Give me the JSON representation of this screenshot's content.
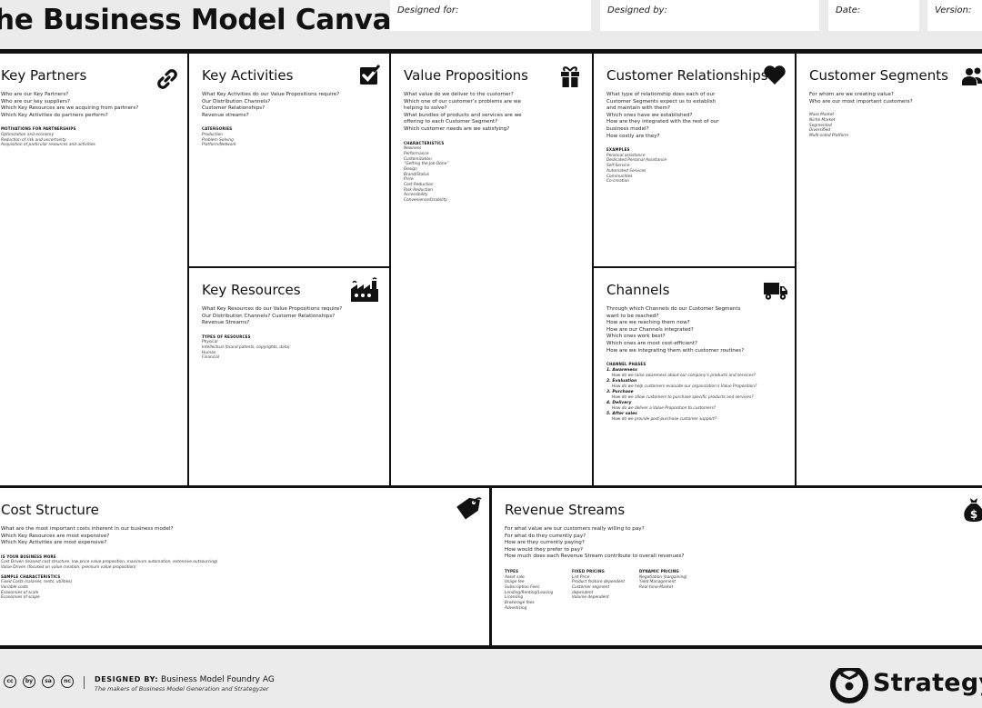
{
  "header": {
    "title": "he Business Model Canvas",
    "designed_for": "Designed for:",
    "designed_by": "Designed by:",
    "date": "Date:",
    "version": "Version:"
  },
  "key_partners": {
    "title": "Key Partners",
    "icon": "link-icon",
    "questions": [
      "Who are our Key Partners?",
      "Who are our key suppliers?",
      "Which Key Resources are we acquiring from partners?",
      "Which Key Activities do partners perform?"
    ],
    "subhead": "MOTIVATIONS FOR PARTNERSHIPS",
    "items": [
      "Optimization and economy",
      "Reduction of risk and uncertainty",
      "Acquisition of particular resources and activities"
    ]
  },
  "key_activities": {
    "title": "Key Activities",
    "icon": "checkbox-icon",
    "questions": [
      "What Key Activities do our Value Propositions require?",
      "Our Distribution Channels?",
      "Customer Relationships?",
      "Revenue streams?"
    ],
    "subhead": "CATERGORIES",
    "items": [
      "Production",
      "Problem Solving",
      "Platform/Network"
    ]
  },
  "key_resources": {
    "title": "Key Resources",
    "icon": "factory-icon",
    "questions": [
      "What Key Resources do our Value Propositions require?",
      "Our Distribution Channels? Customer Relationships?",
      "Revenue Streams?"
    ],
    "subhead": "TYPES OF RESOURCES",
    "items": [
      "Physical",
      "Intellectual (brand patents, copyrights, data)",
      "Human",
      "Financial"
    ]
  },
  "value_propositions": {
    "title": "Value Propositions",
    "icon": "gift-icon",
    "questions": [
      "What value do we deliver to the customer?",
      "Which one of our customer’s problems are we",
      "helping to solve?",
      "What bundles of products and services are we",
      "offering to each Customer Segment?",
      "Which customer needs are we satisfying?"
    ],
    "subhead": "CHARACTERISTICS",
    "items": [
      "Newness",
      "Performance",
      "Customization",
      "“Getting the Job Done”",
      "Design",
      "Brand/Status",
      "Price",
      "Cost Reduction",
      "Risk Reduction",
      "Accessibility",
      "Convenience/Usability"
    ]
  },
  "customer_relationships": {
    "title": "Customer Relationships",
    "icon": "heart-icon",
    "questions": [
      "What type of relationship does each of our",
      "Customer Segments expect us to establish",
      "and maintain with them?",
      "Which ones have we established?",
      "How are they integrated with the rest of our",
      "business model?",
      "How costly are they?"
    ],
    "subhead": "EXAMPLES",
    "items": [
      "Personal assistance",
      "Dedicated Personal Assistance",
      "Self-Service",
      "Automated Services",
      "Communities",
      "Co-creation"
    ]
  },
  "channels": {
    "title": "Channels",
    "icon": "truck-icon",
    "questions": [
      "Through which Channels do our Customer Segments",
      "want to be reached?",
      "How are we reaching them now?",
      "How are our Channels integrated?",
      "Which ones work best?",
      "Which ones are most cost-efficient?",
      "How are we integrating them with customer routines?"
    ],
    "subhead": "CHANNEL PHASES",
    "phases": [
      {
        "name": "1. Awareness",
        "desc": "How do we raise awareness about our company’s products and services?"
      },
      {
        "name": "2. Evaluation",
        "desc": "How do we help customers evaluate our organization’s Value Proposition?"
      },
      {
        "name": "3. Purchase",
        "desc": "How do we allow customers to purchase specific products and services?"
      },
      {
        "name": "4. Delivery",
        "desc": "How do we deliver a Value Proposition to customers?"
      },
      {
        "name": "5. After sales",
        "desc": "How do we provide post-purchase customer support?"
      }
    ]
  },
  "customer_segments": {
    "title": "Customer Segments",
    "icon": "people-icon",
    "questions": [
      "For whom are we creating value?",
      "Who are our most important customers?"
    ],
    "items": [
      "Mass Market",
      "Niche Market",
      "Segmented",
      "Diversified",
      "Multi-sided Platform"
    ]
  },
  "cost_structure": {
    "title": "Cost Structure",
    "icon": "price-tag-icon",
    "questions": [
      "What are the most important costs inherent in our business model?",
      "Which Key Resources are most expensive?",
      "Which Key Activities are most expensive?"
    ],
    "subhead": "IS YOUR BUSINESS MORE",
    "items": [
      "Cost Driven (leanest cost structure, low price value proposition, maximum automation, extensive outsourcing)",
      "Value Driven (focused on value creation, premium value proposition)"
    ],
    "subhead2": "SAMPLE CHARACTERISTICS",
    "items2": [
      "Fixed Costs (salaries, rents, utilities)",
      "Variable costs",
      "Economies of scale",
      "Economies of scope"
    ]
  },
  "revenue_streams": {
    "title": "Revenue Streams",
    "icon": "money-bag-icon",
    "questions": [
      "For what value are our customers really willing to pay?",
      "For what do they currently pay?",
      "How are they currently paying?",
      "How would they prefer to pay?",
      "How much does each Revenue Stream contribute to overall revenues?"
    ],
    "groups": [
      {
        "head": "TYPES",
        "items": [
          "Asset sale",
          "Usage fee",
          "Subscription Fees",
          "Lending/Renting/Leasing",
          "Licensing",
          "Brokerage fees",
          "Advertising"
        ]
      },
      {
        "head": "FIXED PRICING",
        "items": [
          "List Price",
          "Product feature dependent",
          "Customer segment",
          "dependent",
          "Volume dependent"
        ]
      },
      {
        "head": "DYNAMIC PRICING",
        "items": [
          "Negotiation (bargaining)",
          "Yield Management",
          "Real-time-Market"
        ]
      }
    ]
  },
  "footer": {
    "license_icons": [
      "cc",
      "by",
      "sa",
      "nc"
    ],
    "designed_by_label": "DESIGNED BY:",
    "designed_by_value": "Business Model Foundry AG",
    "tagline": "The makers of Business Model Generation and Strategyzer",
    "logo_text": "Strategyze"
  }
}
